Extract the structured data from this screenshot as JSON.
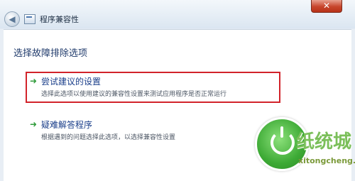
{
  "window": {
    "title": "程序兼容性",
    "close_label": "✕"
  },
  "main": {
    "heading": "选择故障排除选项",
    "options": [
      {
        "title": "尝试建议的设置",
        "description": "选择此选项以使用建议的兼容性设置来测试应用程序是否正常运行",
        "highlighted": true
      },
      {
        "title": "疑难解答程序",
        "description": "根据遇到的问题选择此选项，以选择兼容性设置",
        "highlighted": false
      }
    ]
  },
  "watermark": {
    "brand": "纸统城",
    "url": "xitongcheng.com"
  },
  "colors": {
    "highlight_border": "#d2232a",
    "arrow": "#2f9b3a",
    "link": "#1a3e8a"
  }
}
